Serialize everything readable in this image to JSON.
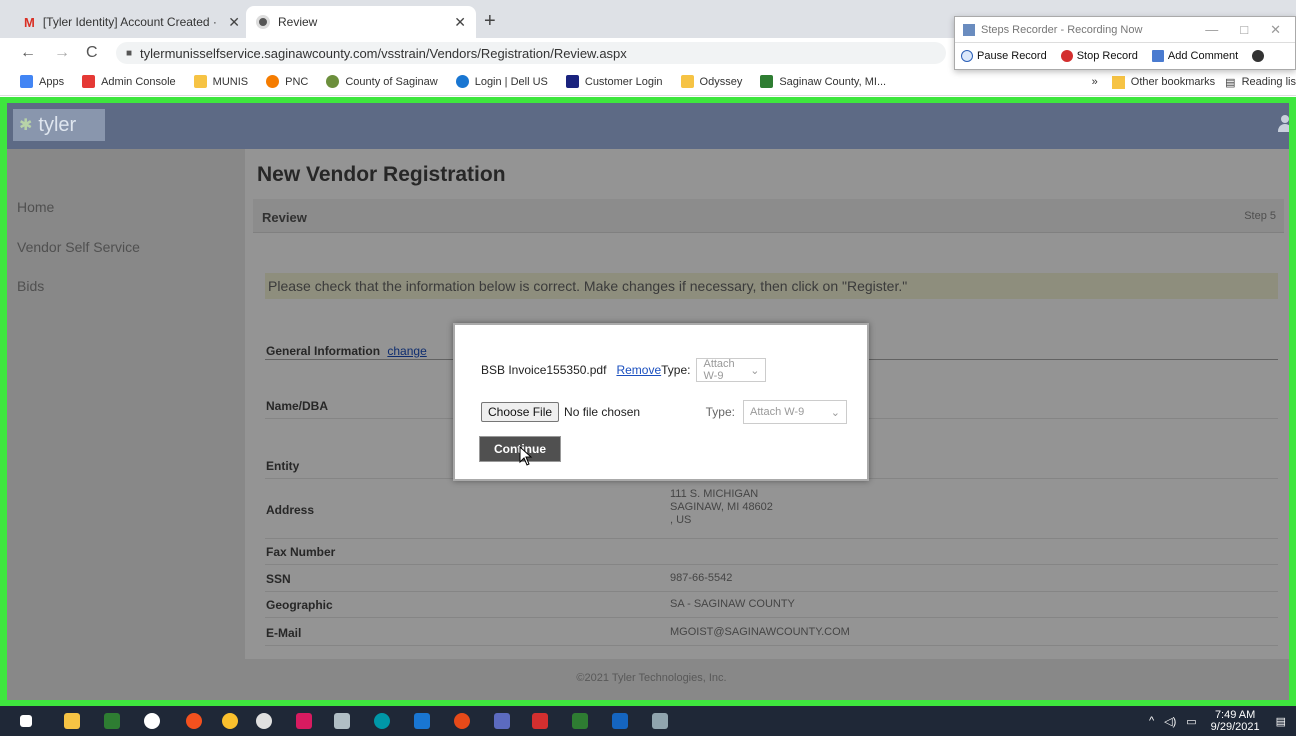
{
  "browser": {
    "tabs": [
      {
        "title": "[Tyler Identity] Account Created ·",
        "active": false
      },
      {
        "title": "Review",
        "active": true
      }
    ],
    "new_tab": "+",
    "tab_close": "✕",
    "url": "tylermunisselfservice.saginawcounty.com/vsstrain/Vendors/Registration/Review.aspx",
    "bookmarks": [
      {
        "label": "Apps",
        "color": "#ea4335"
      },
      {
        "label": "Admin Console",
        "color": "#e53935"
      },
      {
        "label": "MUNIS",
        "color": "#f6c344"
      },
      {
        "label": "PNC",
        "color": "#f57c00"
      },
      {
        "label": "County of Saginaw",
        "color": "#6c8f3c"
      },
      {
        "label": "Login | Dell US",
        "color": "#1976d2"
      },
      {
        "label": "Customer Login",
        "color": "#1a237e"
      },
      {
        "label": "Odyssey",
        "color": "#f6c344"
      },
      {
        "label": "Saginaw County, MI...",
        "color": "#2e7d32"
      }
    ],
    "bookmarks_more": "»",
    "other_bookmarks": "Other bookmarks",
    "reading_list": "Reading lis"
  },
  "recorder": {
    "title": "Steps Recorder - Recording Now",
    "pause": "Pause Record",
    "stop": "Stop Record",
    "comment": "Add Comment"
  },
  "app": {
    "logo": "tyler",
    "nav": [
      "Home",
      "Vendor Self Service",
      "Bids"
    ],
    "page_title": "New Vendor Registration",
    "review_label": "Review",
    "step_label": "Step 5",
    "notice": "Please check that the information below is correct. Make changes if necessary, then click on \"Register.\"",
    "general_info": "General Information",
    "change_link": "change",
    "fields": [
      {
        "label": "Name/DBA",
        "value": ""
      },
      {
        "label": "Entity",
        "value": ""
      },
      {
        "label": "Address",
        "value": "111 S. MICHIGAN\nSAGINAW, MI 48602\n, US"
      },
      {
        "label": "Fax Number",
        "value": ""
      },
      {
        "label": "SSN",
        "value": "987-66-5542"
      },
      {
        "label": "Geographic",
        "value": "SA - SAGINAW COUNTY"
      },
      {
        "label": "E-Mail",
        "value": "MGOIST@SAGINAWCOUNTY.COM"
      }
    ],
    "footer": "©2021 Tyler Technologies, Inc."
  },
  "modal": {
    "file_name": "BSB Invoice155350.pdf",
    "remove_link": "Remove",
    "type_label": "Type:",
    "type_value": "Attach W-9",
    "choose_file": "Choose File",
    "no_file": "No file chosen",
    "continue": "Continue"
  },
  "taskbar": {
    "time": "7:49 AM",
    "date": "9/29/2021"
  }
}
